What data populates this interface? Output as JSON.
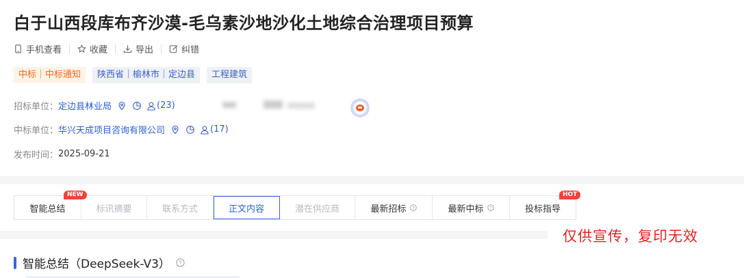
{
  "page": {
    "title": "白于山西段库布齐沙漠-毛乌素沙地沙化土地综合治理项目预算"
  },
  "actions": [
    {
      "label": "手机查看",
      "icon": "mobile-icon"
    },
    {
      "label": "收藏",
      "icon": "star-icon"
    },
    {
      "label": "导出",
      "icon": "download-icon"
    },
    {
      "label": "纠错",
      "icon": "edit-icon"
    }
  ],
  "tags": {
    "status": "中标｜中标通知",
    "region": "陕西省｜榆林市｜定边县",
    "category": "工程建筑"
  },
  "tenderer": {
    "label": "招标单位：",
    "name": "定边县林业局",
    "count": "(23)"
  },
  "winner": {
    "label": "中标单位：",
    "name": "华兴天成项目咨询有限公司",
    "count": "(17)"
  },
  "publish": {
    "label": "发布时间：",
    "date": "2025-09-21"
  },
  "tabs": [
    {
      "label": "智能总结",
      "state": "normal",
      "badge": "NEW"
    },
    {
      "label": "标讯摘要",
      "state": "disabled"
    },
    {
      "label": "联系方式",
      "state": "disabled"
    },
    {
      "label": "正文内容",
      "state": "active"
    },
    {
      "label": "潜在供应商",
      "state": "disabled"
    },
    {
      "label": "最新招标",
      "state": "normal",
      "help": true
    },
    {
      "label": "最新中标",
      "state": "normal",
      "help": true
    },
    {
      "label": "投标指导",
      "state": "normal",
      "badge": "HOT"
    }
  ],
  "watermark": "仅供宣传，复印无效",
  "section": {
    "title": "智能总结（DeepSeek-V3）"
  },
  "colors": {
    "link": "#2f5fd0",
    "accent": "#3a66d4",
    "badge": "#f2423a",
    "watermark": "#e02424",
    "orange_tag": "#f26b1d"
  }
}
